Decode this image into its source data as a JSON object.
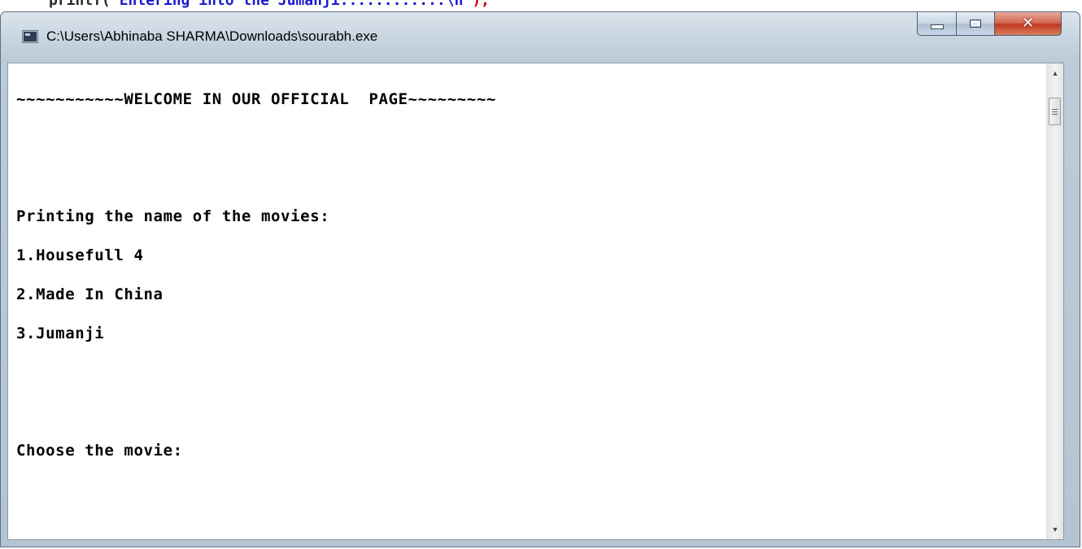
{
  "background": {
    "code_fragment_keyword": "printf(",
    "code_fragment_string": "\"Entering into the Jumanji............\\n\"",
    "code_fragment_end": ");"
  },
  "window": {
    "title": "C:\\Users\\Abhinaba SHARMA\\Downloads\\sourabh.exe",
    "icon": "console-app-icon",
    "buttons": {
      "minimize": "minimize-icon",
      "maximize": "maximize-icon",
      "close": "close-icon"
    }
  },
  "console": {
    "lines": [
      "~~~~~~~~~~~WELCOME IN OUR OFFICIAL  PAGE~~~~~~~~~",
      "",
      "",
      "Printing the name of the movies:",
      "1.Housefull 4",
      "2.Made In China",
      "3.Jumanji",
      "",
      "",
      "Choose the movie:"
    ]
  },
  "colors": {
    "accent_close": "#c0391f",
    "console_bg": "#ffffff",
    "console_text": "#000000"
  }
}
